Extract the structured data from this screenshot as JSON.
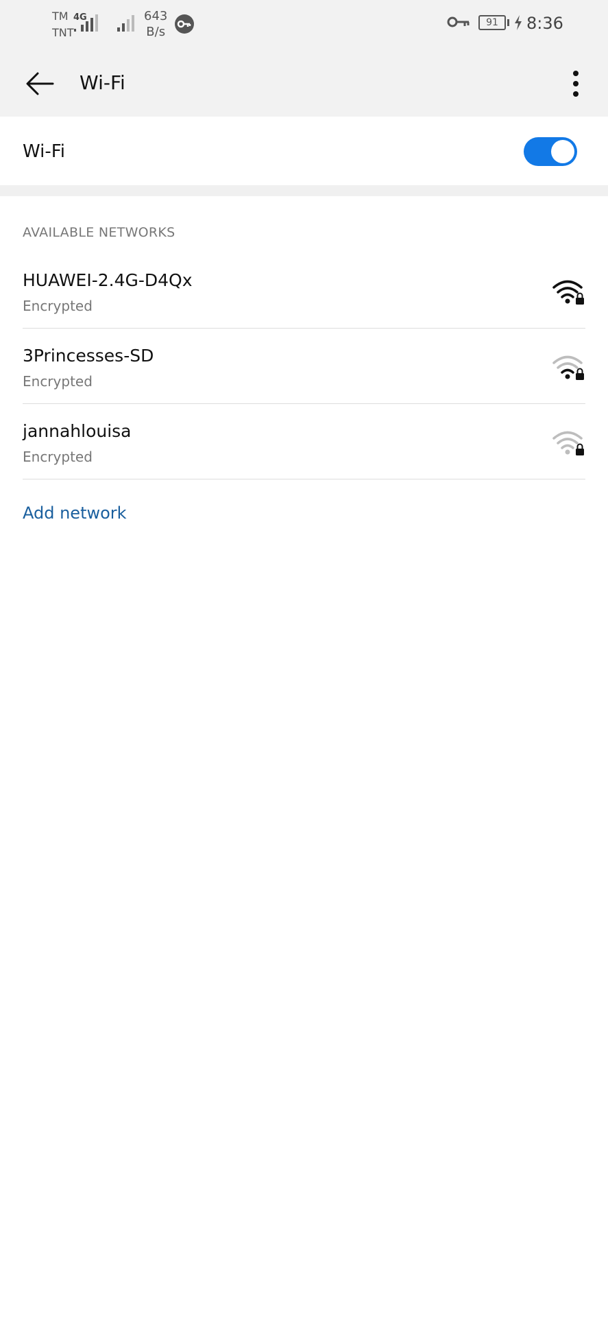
{
  "status_bar": {
    "carrier_1": "TM",
    "carrier_2": "TNT",
    "network_type": "4G",
    "speed_value": "643",
    "speed_unit": "B/s",
    "battery": "91",
    "time": "8:36"
  },
  "app_bar": {
    "title": "Wi-Fi",
    "back_icon": "back-arrow-icon",
    "more_icon": "more-vertical-icon"
  },
  "wifi_toggle": {
    "label": "Wi-Fi",
    "state": "on",
    "accent": "#1279e6"
  },
  "available_networks": {
    "header": "AVAILABLE NETWORKS",
    "items": [
      {
        "name": "HUAWEI-2.4G-D4Qx",
        "status": "Encrypted",
        "signal_bars": 4,
        "locked": true
      },
      {
        "name": "3Princesses-SD",
        "status": "Encrypted",
        "signal_bars": 2,
        "locked": true
      },
      {
        "name": "jannahlouisa",
        "status": "Encrypted",
        "signal_bars": 1,
        "locked": true
      }
    ]
  },
  "add_network": {
    "label": "Add network",
    "color": "#1a5f9e"
  }
}
